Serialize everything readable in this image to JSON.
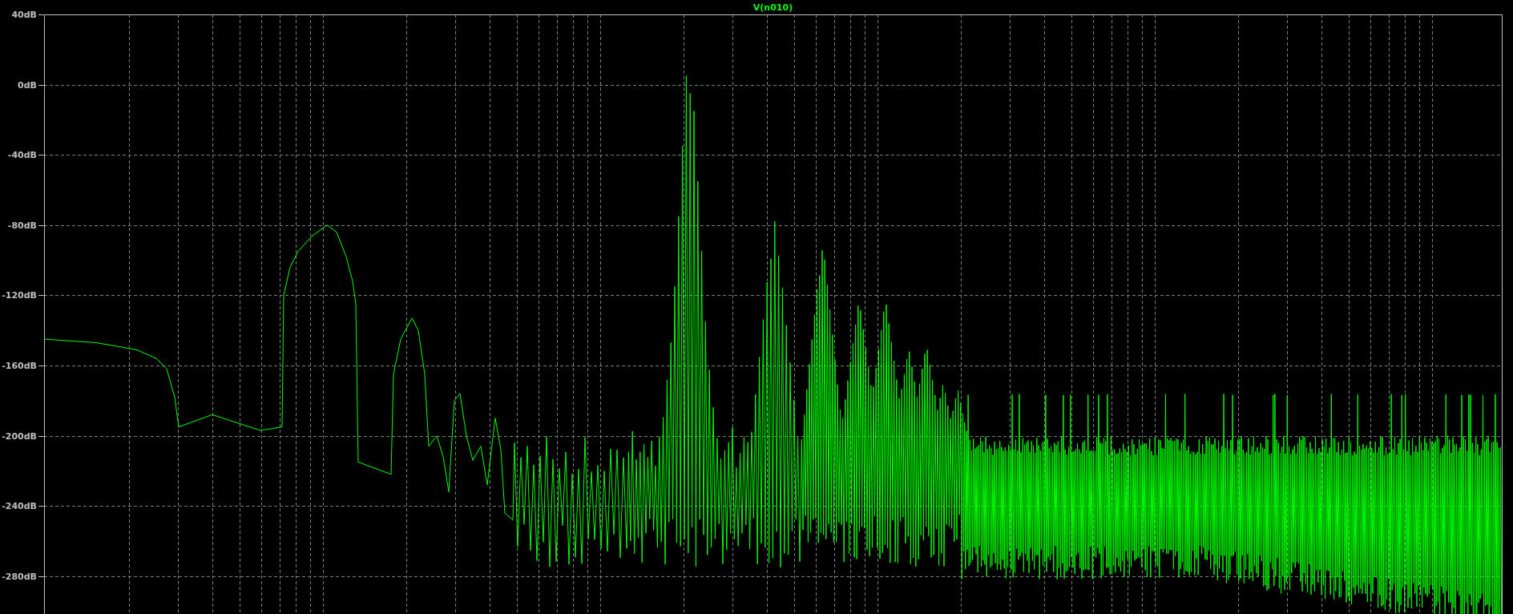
{
  "plot": {
    "title": "V(n010)",
    "y_axis": {
      "labels": [
        "40dB",
        "0dB",
        "-40dB",
        "-80dB",
        "-120dB",
        "-160dB",
        "-200dB",
        "-240dB",
        "-280dB"
      ]
    }
  }
}
